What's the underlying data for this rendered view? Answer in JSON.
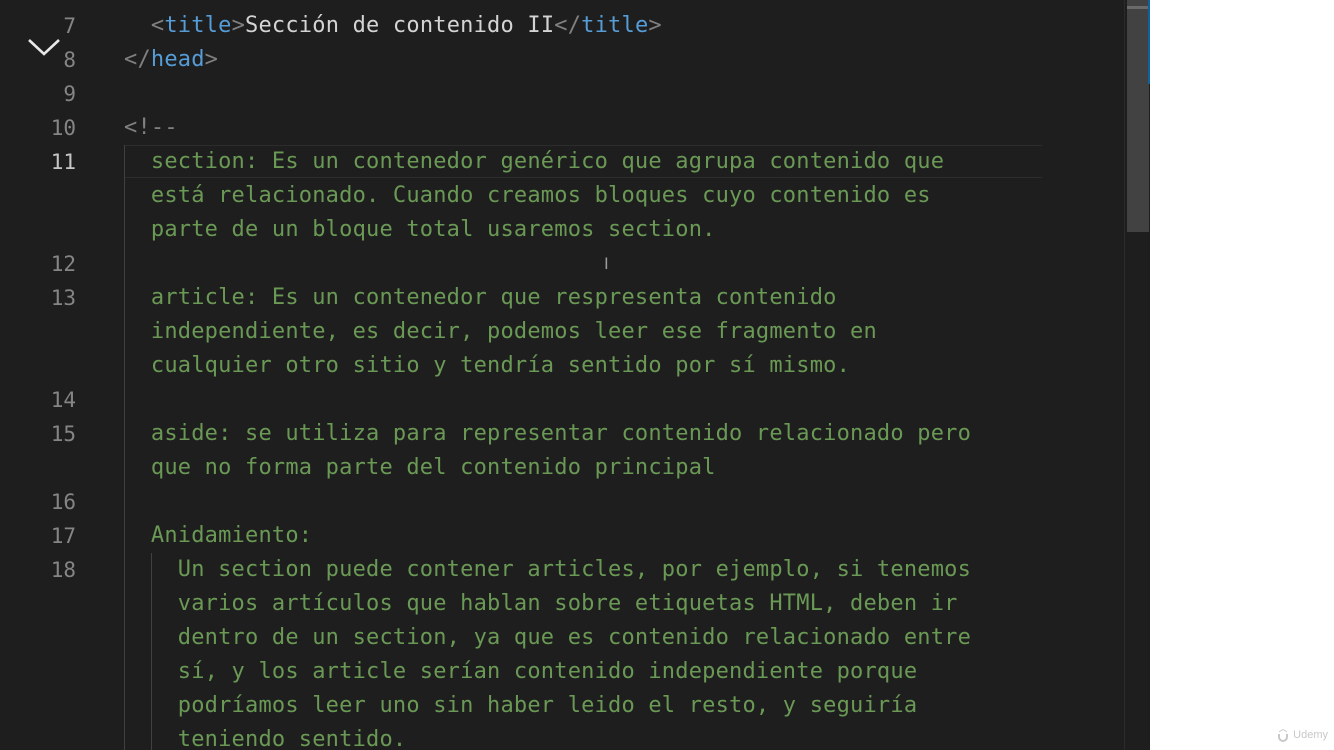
{
  "editor": {
    "lines": [
      {
        "num": "7",
        "parts": [
          {
            "t": "  ",
            "c": "plain"
          },
          {
            "t": "<",
            "c": "tag-br"
          },
          {
            "t": "title",
            "c": "tag-nm"
          },
          {
            "t": ">",
            "c": "tag-br"
          },
          {
            "t": "Sección de contenido II",
            "c": "plain"
          },
          {
            "t": "</",
            "c": "tag-br"
          },
          {
            "t": "title",
            "c": "tag-nm"
          },
          {
            "t": ">",
            "c": "tag-br"
          }
        ]
      },
      {
        "num": "8",
        "parts": [
          {
            "t": "</",
            "c": "tag-br"
          },
          {
            "t": "head",
            "c": "tag-nm"
          },
          {
            "t": ">",
            "c": "tag-br"
          }
        ]
      },
      {
        "num": "9",
        "parts": []
      },
      {
        "num": "10",
        "parts": [
          {
            "t": "<!--",
            "c": "tag-br"
          }
        ]
      },
      {
        "num": "11",
        "active": true,
        "parts": [
          {
            "t": "  section: Es un contenedor genérico que agrupa contenido que",
            "c": "cmt"
          }
        ]
      },
      {
        "num": "",
        "parts": [
          {
            "t": "  está relacionado. Cuando creamos bloques cuyo contenido es",
            "c": "cmt"
          }
        ]
      },
      {
        "num": "",
        "parts": [
          {
            "t": "  parte de un bloque total usaremos section.",
            "c": "cmt"
          }
        ]
      },
      {
        "num": "12",
        "parts": []
      },
      {
        "num": "13",
        "parts": [
          {
            "t": "  article: Es un contenedor que respresenta contenido",
            "c": "cmt"
          }
        ]
      },
      {
        "num": "",
        "parts": [
          {
            "t": "  independiente, es decir, podemos leer ese fragmento en",
            "c": "cmt"
          }
        ]
      },
      {
        "num": "",
        "parts": [
          {
            "t": "  cualquier otro sitio y tendría sentido por sí mismo.",
            "c": "cmt"
          }
        ]
      },
      {
        "num": "14",
        "parts": []
      },
      {
        "num": "15",
        "parts": [
          {
            "t": "  aside: se utiliza para representar contenido relacionado pero",
            "c": "cmt"
          }
        ]
      },
      {
        "num": "",
        "parts": [
          {
            "t": "  que no forma parte del contenido principal",
            "c": "cmt"
          }
        ]
      },
      {
        "num": "16",
        "parts": []
      },
      {
        "num": "17",
        "parts": [
          {
            "t": "  Anidamiento:",
            "c": "cmt"
          }
        ]
      },
      {
        "num": "18",
        "parts": [
          {
            "t": "    Un section puede contener articles, por ejemplo, si tenemos",
            "c": "cmt"
          }
        ]
      },
      {
        "num": "",
        "parts": [
          {
            "t": "    varios artículos que hablan sobre etiquetas HTML, deben ir",
            "c": "cmt"
          }
        ]
      },
      {
        "num": "",
        "parts": [
          {
            "t": "    dentro de un section, ya que es contenido relacionado entre",
            "c": "cmt"
          }
        ]
      },
      {
        "num": "",
        "parts": [
          {
            "t": "    sí, y los article serían contenido independiente porque",
            "c": "cmt"
          }
        ]
      },
      {
        "num": "",
        "parts": [
          {
            "t": "    podríamos leer uno sin haber leido el resto, y seguiría",
            "c": "cmt"
          }
        ]
      },
      {
        "num": "",
        "parts": [
          {
            "t": "    teniendo sentido.",
            "c": "cmt"
          }
        ]
      }
    ],
    "scrollbar_color": "#424242",
    "comment_color": "#6a9955",
    "tag_color": "#569cd6"
  },
  "icons": {
    "collapse": "chevron-down-icon",
    "cursor": "text-cursor-icon",
    "watermark": "udemy-logo"
  },
  "watermark": {
    "text": "Udemy"
  }
}
